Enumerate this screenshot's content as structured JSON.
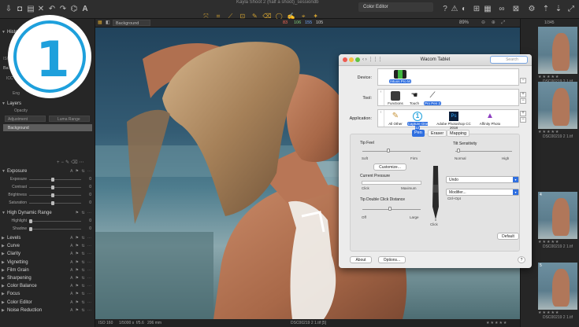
{
  "toolbar": {
    "doc_title": "Kayla Shoot 2 (half a shoot)_sessiondb",
    "color_editor_tab": "Color Editor",
    "accent": "#d0a030"
  },
  "canvas": {
    "style_label": "Background",
    "levels": [
      "83",
      "106",
      "155",
      "105"
    ],
    "zoom": "89%",
    "nav": "1/345"
  },
  "status": {
    "camera": "ISO 160",
    "shutter": "1/5000 s",
    "aperture": "f/5.6",
    "focal": "206 mm",
    "file": "DSC00219 2 1.tif [5]",
    "stars": "★★★★★"
  },
  "left_panel": {
    "histogram": "Histogram",
    "iso": "ISO 1",
    "base": "Ba",
    "icc": "ICC",
    "eng": "Eng",
    "layers": "Layers",
    "opacity": "Opacity",
    "adjustment": "Adjustment",
    "luma_range": "Luma Range",
    "background": "Background",
    "exposure": {
      "title": "Exposure",
      "rows": [
        {
          "label": "Exposure",
          "value": "0",
          "pos": 0.45
        },
        {
          "label": "Contrast",
          "value": "0",
          "pos": 0.45
        },
        {
          "label": "Brightness",
          "value": "0",
          "pos": 0.45
        },
        {
          "label": "Saturation",
          "value": "0",
          "pos": 0.45
        }
      ]
    },
    "hdr": {
      "title": "High Dynamic Range",
      "rows": [
        {
          "label": "Highlight",
          "value": "0",
          "pos": 0.03
        },
        {
          "label": "Shadow",
          "value": "0",
          "pos": 0.03
        }
      ]
    },
    "tools": [
      "Levels",
      "Curve",
      "Clarity",
      "Vignetting",
      "Film Grain",
      "Sharpening",
      "Color Balance",
      "Focus",
      "Color Editor",
      "Noise Reduction"
    ]
  },
  "filmstrip": {
    "counter": "1/345",
    "thumbs": [
      {
        "name": "DSC00219 2 1.tif",
        "num": ""
      },
      {
        "name": "DSC00219 2 1.tif",
        "num": ""
      },
      {
        "name": "DSC00219 2 1.tif",
        "num": "4"
      },
      {
        "name": "DSC00219 2 1.tif",
        "num": "5"
      }
    ],
    "stars": "★★★★★"
  },
  "logo": {
    "numeral": "1",
    "color": "#1ea0dc"
  },
  "wacom": {
    "title": "Wacom Tablet",
    "search_placeholder": "Search",
    "device_label": "Device:",
    "device_item": "Intuos Pro M",
    "tool_label": "Tool:",
    "tools": [
      "Functions",
      "Touch",
      "Pro Pen 2"
    ],
    "app_label": "Application:",
    "apps": [
      "All Other",
      "Capture One 12",
      "Adobe Photoshop CC 2018",
      "Affinity Photo"
    ],
    "tabs": [
      "Pen",
      "Eraser",
      "Mapping"
    ],
    "tip_feel": "Tip Feel",
    "soft": "Soft",
    "firm": "Firm",
    "customize": "Customize...",
    "current_pressure": "Current Pressure",
    "click": "Click",
    "maximum": "Maximum",
    "tip_double": "Tip Double Click Distance",
    "off": "Off",
    "large": "Large",
    "tilt": "Tilt Sensitivity",
    "normal": "Normal",
    "high": "High",
    "undo": "Undo",
    "modifier": "Modifier...",
    "ctrl_opt": "Ctrl+Opt",
    "pen_click": "Click",
    "default_btn": "Default",
    "about_btn": "About",
    "options_btn": "Options...",
    "help": "?",
    "select_color": "#2f6fe0"
  }
}
